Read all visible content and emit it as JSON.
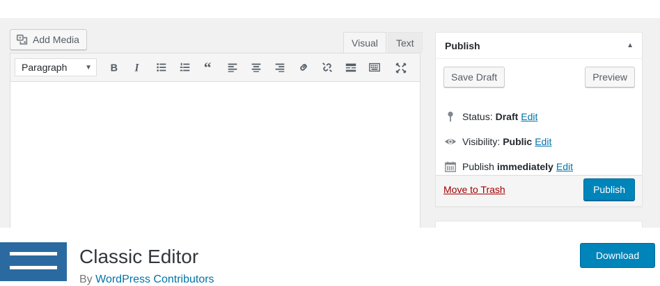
{
  "editor": {
    "add_media_label": "Add Media",
    "tabs": [
      {
        "label": "Visual",
        "active": true
      },
      {
        "label": "Text",
        "active": false
      }
    ],
    "format_select": "Paragraph",
    "toolbar_icons": [
      "bold-icon",
      "italic-icon",
      "bullet-list-icon",
      "numbered-list-icon",
      "blockquote-icon",
      "align-left-icon",
      "align-center-icon",
      "align-right-icon",
      "link-icon",
      "unlink-icon",
      "read-more-icon",
      "toolbar-toggle-icon",
      "fullscreen-icon"
    ]
  },
  "publish": {
    "title": "Publish",
    "save_draft_label": "Save Draft",
    "preview_label": "Preview",
    "status_label": "Status:",
    "status_value": "Draft",
    "status_edit": "Edit",
    "visibility_label": "Visibility:",
    "visibility_value": "Public",
    "visibility_edit": "Edit",
    "schedule_label": "Publish",
    "schedule_value": "immediately",
    "schedule_edit": "Edit",
    "trash_label": "Move to Trash",
    "publish_label": "Publish"
  },
  "plugin": {
    "name": "Classic Editor",
    "author_prefix": "By",
    "author_name": "WordPress Contributors",
    "download_label": "Download"
  },
  "colors": {
    "primary": "#0085ba",
    "link": "#0073aa",
    "trash": "#a00000",
    "plugin_icon": "#2a6aa0"
  }
}
